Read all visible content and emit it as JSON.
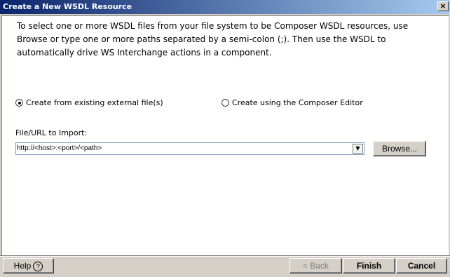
{
  "window": {
    "title": "Create a New WSDL Resource",
    "close_glyph": "×"
  },
  "intro_text": "To select one or more WSDL files from your file system to be Composer WSDL  resources, use Browse or type one or more paths separated by a semi-colon (;). Then use the WSDL to automatically drive WS Interchange actions in a component.",
  "options": {
    "existing_file": {
      "label": "Create from existing external file(s)",
      "selected": true
    },
    "composer_editor": {
      "label": "Create using the Composer Editor",
      "selected": false
    }
  },
  "import": {
    "label": "File/URL to Import:",
    "value": "http://<host>:<port>/<path>",
    "browse_label": "Browse..."
  },
  "footer": {
    "help_label": "Help",
    "help_icon": "?",
    "back_label": "< Back",
    "finish_label": "Finish",
    "cancel_label": "Cancel"
  }
}
